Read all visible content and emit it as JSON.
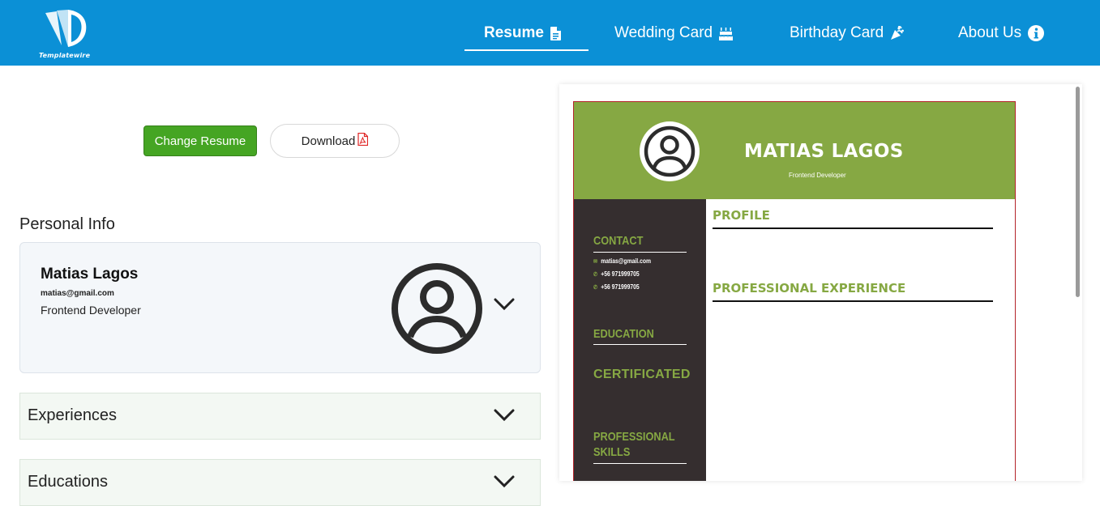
{
  "brand": {
    "logo_text": "Templatewire"
  },
  "nav": {
    "items": [
      {
        "label": "Resume",
        "icon": "file-text-icon"
      },
      {
        "label": "Wedding Card",
        "icon": "cake-icon"
      },
      {
        "label": "Birthday Card",
        "icon": "party-icon"
      },
      {
        "label": "About Us",
        "icon": "info-icon"
      }
    ],
    "active": "Resume"
  },
  "actions": {
    "change_label": "Change Resume",
    "download_label": "Download"
  },
  "personal": {
    "section_title": "Personal Info",
    "name": "Matias Lagos",
    "email": "matias@gmail.com",
    "role": "Frontend Developer"
  },
  "accordions": [
    {
      "label": "Experiences"
    },
    {
      "label": "Educations"
    }
  ],
  "resume": {
    "name": "MATIAS LAGOS",
    "title": "Frontend Developer",
    "sidebar": {
      "contact_heading": "CONTACT",
      "email": "matias@gmail.com",
      "phone_1": "+56 971999705",
      "phone_2": "+56 971999705",
      "education_heading": "EDUCATION",
      "certificated_heading": "CERTIFICATED",
      "skills_heading_1": "PROFESSIONAL",
      "skills_heading_2": "SKILLS"
    },
    "main": {
      "profile_heading": "PROFILE",
      "experience_heading": "PROFESSIONAL EXPERIENCE"
    }
  },
  "colors": {
    "navbar": "#0b90d6",
    "change_button": "#45a523",
    "resume_accent": "#86a843",
    "resume_sidebar": "#352e2f",
    "resume_border": "#b4232a"
  }
}
